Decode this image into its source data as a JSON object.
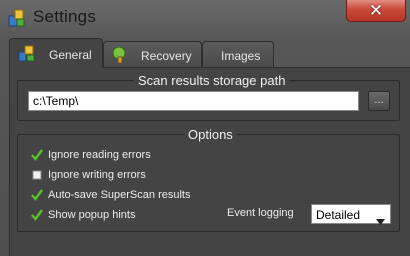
{
  "window": {
    "title": "Settings",
    "close_glyph": "✕"
  },
  "tabs": [
    {
      "label": "General",
      "icon": "general-icon",
      "active": true
    },
    {
      "label": "Recovery",
      "icon": "recovery-icon",
      "active": false
    },
    {
      "label": "Images",
      "active": false
    }
  ],
  "storage": {
    "title": "Scan results storage path",
    "path_value": "c:\\Temp\\",
    "browse_label": "..."
  },
  "options": {
    "title": "Options",
    "items": [
      {
        "label": "Ignore reading errors",
        "checked": true
      },
      {
        "label": "Ignore writing errors",
        "checked": false
      },
      {
        "label": "Auto-save SuperScan results",
        "checked": true
      },
      {
        "label": "Show popup hints",
        "checked": true
      }
    ],
    "event_logging": {
      "label": "Event logging",
      "value": "Detailed"
    }
  },
  "colors": {
    "accent_check": "#5bbf2a",
    "close_red": "#c8493b",
    "panel_bg": "#444444"
  }
}
